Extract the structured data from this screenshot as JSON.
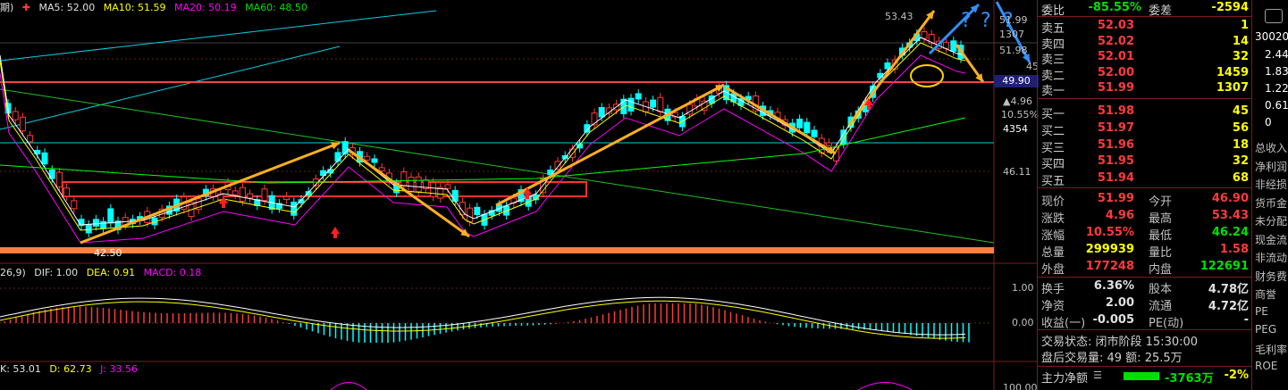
{
  "ma_bar": {
    "ma5": "MA5: 52.00",
    "ma10": "MA10: 51.59",
    "ma20": "MA20: 50.19",
    "ma60": "MA60: 48.50"
  },
  "macd_bar": {
    "params": "26,9)",
    "dif": "DIF: 1.00",
    "dea": "DEA: 0.91",
    "macd": "MACD: 0.18"
  },
  "kdj_bar": {
    "k": "K: 53.01",
    "d": "D: 62.73",
    "j": "J: 33.56"
  },
  "price_labels": {
    "high": "53.43",
    "low": "42.50",
    "p1": "51.99",
    "p2": "1307",
    "p3": "51.98",
    "p4": "45",
    "current": "49.90",
    "change": "▲4.96",
    "change_pct": "10.55%",
    "vol": "4354",
    "level": "46.11"
  },
  "macd_axis": [
    "1.00",
    "0.00"
  ],
  "kdj_axis": [
    "100.00"
  ],
  "order_book": {
    "weibi_label": "委比",
    "weibi_value": "-85.55%",
    "weicha_label": "委差",
    "weicha_value": "-2594",
    "asks": [
      {
        "label": "卖五",
        "price": "52.03",
        "vol": "1"
      },
      {
        "label": "卖四",
        "price": "52.02",
        "vol": "14"
      },
      {
        "label": "卖三",
        "price": "52.01",
        "vol": "32"
      },
      {
        "label": "卖二",
        "price": "52.00",
        "vol": "1459"
      },
      {
        "label": "卖一",
        "price": "51.99",
        "vol": "1307"
      }
    ],
    "bids": [
      {
        "label": "买一",
        "price": "51.98",
        "vol": "45"
      },
      {
        "label": "买二",
        "price": "51.97",
        "vol": "56"
      },
      {
        "label": "买三",
        "price": "51.96",
        "vol": "18"
      },
      {
        "label": "买四",
        "price": "51.95",
        "vol": "32"
      },
      {
        "label": "买五",
        "price": "51.94",
        "vol": "68"
      }
    ]
  },
  "stats": [
    {
      "l1": "现价",
      "v1": "51.99",
      "l2": "今开",
      "v2": "46.90"
    },
    {
      "l1": "涨跌",
      "v1": "4.96",
      "l2": "最高",
      "v2": "53.43"
    },
    {
      "l1": "涨幅",
      "v1": "10.55%",
      "l2": "最低",
      "v2": "46.24"
    },
    {
      "l1": "总量",
      "v1": "299939",
      "l2": "量比",
      "v2": "1.58"
    },
    {
      "l1": "外盘",
      "v1": "177248",
      "l2": "内盘",
      "v2": "122691"
    }
  ],
  "stats2": [
    {
      "l1": "换手",
      "v1": "6.36%",
      "l2": "股本",
      "v2": "4.78亿"
    },
    {
      "l1": "净资",
      "v1": "2.00",
      "l2": "流通",
      "v2": "4.72亿"
    },
    {
      "l1": "收益(一)",
      "v1": "-0.005",
      "l2": "PE(动)",
      "v2": "-"
    }
  ],
  "trade_status": "交易状态: 闭市阶段 15:30:00",
  "after_hours": "盘后交易量: 49  额: 25.5万",
  "main_flow": {
    "label": "主力净额",
    "value": "-3763万",
    "pct": "-2%"
  },
  "right_strip": {
    "code": "30020",
    "nums": [
      "2.44",
      "1.83",
      "1.22",
      "0.61",
      "0"
    ],
    "menu": [
      "总收入",
      "净利润",
      "非经损",
      "货币金",
      "未分配",
      "现金流",
      "非流动",
      "财务费",
      "商誉",
      "PE",
      "PEG",
      "毛利率",
      "ROE"
    ]
  },
  "colors": {
    "up": "#ff3a3a",
    "down": "#00ffff",
    "ma5": "#ffffff",
    "ma10": "#ffff00",
    "ma20": "#ff00ff",
    "ma60": "#00ff00",
    "annot": "#ffb020"
  }
}
